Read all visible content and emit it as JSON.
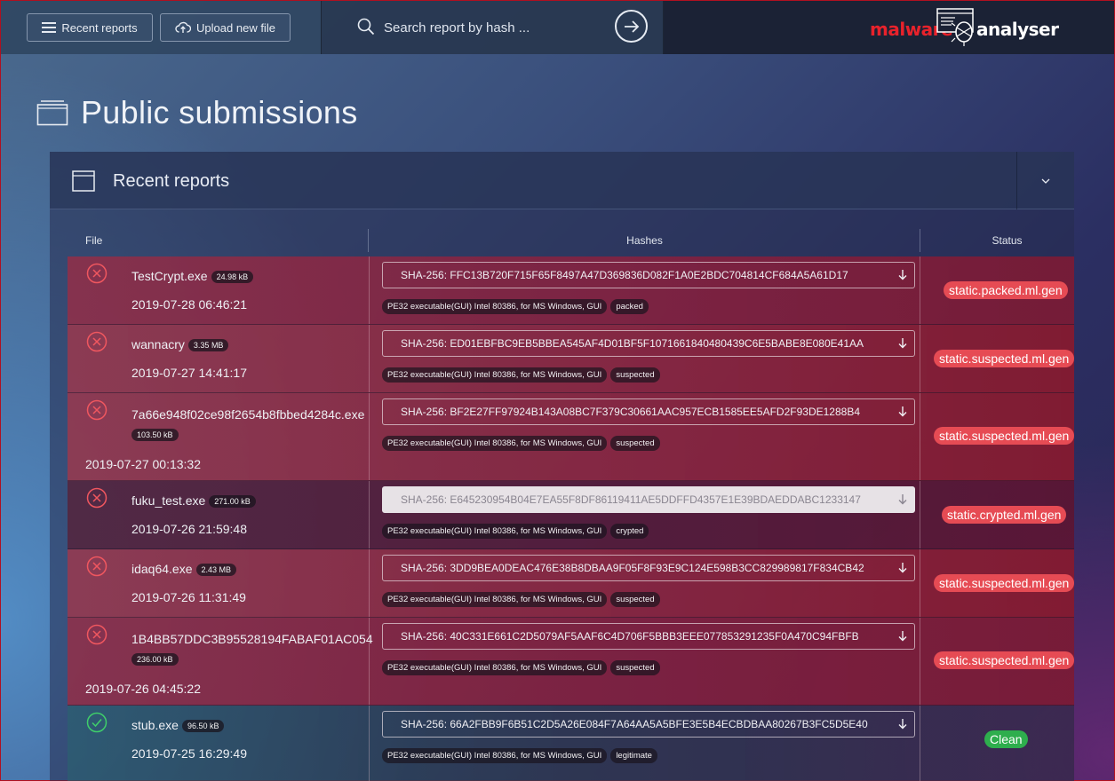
{
  "topbar": {
    "recent_label": "Recent reports",
    "upload_label": "Upload new file",
    "search_placeholder": "Search report by hash ...",
    "logo_part1": "malware",
    "logo_part2": "analyser"
  },
  "page": {
    "title": "Public submissions"
  },
  "panel": {
    "title": "Recent reports",
    "columns": {
      "file": "File",
      "hashes": "Hashes",
      "status": "Status"
    },
    "rows": [
      {
        "status_icon": "error-circle-icon",
        "name": "TestCrypt.exe",
        "size": "24.98 kB",
        "date": "2019-07-28 06:46:21",
        "hash": "SHA-256: FFC13B720F715F65F8497A47D369836D082F1A0E2BDC704814CF684A5A61D17",
        "type_tag": "PE32 executable(GUI) Intel 80386, for MS Windows, GUI",
        "class_tag": "packed",
        "status": "static.packed.ml.gen"
      },
      {
        "status_icon": "error-circle-icon",
        "name": "wannacry",
        "size": "3.35 MB",
        "date": "2019-07-27 14:41:17",
        "hash": "SHA-256: ED01EBFBC9EB5BBEA545AF4D01BF5F1071661840480439C6E5BABE8E080E41AA",
        "type_tag": "PE32 executable(GUI) Intel 80386, for MS Windows, GUI",
        "class_tag": "suspected",
        "status": "static.suspected.ml.gen"
      },
      {
        "status_icon": "error-circle-icon",
        "name": "7a66e948f02ce98f2654b8fbbed4284c.exe",
        "size": "103.50 kB",
        "date": "2019-07-27 00:13:32",
        "hash": "SHA-256: BF2E27FF97924B143A08BC7F379C30661AAC957ECB1585EE5AFD2F93DE1288B4",
        "type_tag": "PE32 executable(GUI) Intel 80386, for MS Windows, GUI",
        "class_tag": "suspected",
        "status": "static.suspected.ml.gen"
      },
      {
        "status_icon": "error-circle-icon",
        "name": "fuku_test.exe",
        "size": "271.00 kB",
        "date": "2019-07-26 21:59:48",
        "hash": "SHA-256: E645230954B04E7EA55F8DF86119411AE5DDFFD4357E1E39BDAEDDABC1233147",
        "type_tag": "PE32 executable(GUI) Intel 80386, for MS Windows, GUI",
        "class_tag": "crypted",
        "status": "static.crypted.ml.gen"
      },
      {
        "status_icon": "error-circle-icon",
        "name": "idaq64.exe",
        "size": "2.43 MB",
        "date": "2019-07-26 11:31:49",
        "hash": "SHA-256: 3DD9BEA0DEAC476E38B8DBAA9F05F8F93E9C124E598B3CC829989817F834CB42",
        "type_tag": "PE32 executable(GUI) Intel 80386, for MS Windows, GUI",
        "class_tag": "suspected",
        "status": "static.suspected.ml.gen"
      },
      {
        "status_icon": "error-circle-icon",
        "name": "1B4BB57DDC3B95528194FABAF01AC054",
        "size": "236.00 kB",
        "date": "2019-07-26 04:45:22",
        "hash": "SHA-256: 40C331E661C2D5079AF5AAF6C4D706F5BBB3EEE077853291235F0A470C94FBFB",
        "type_tag": "PE32 executable(GUI) Intel 80386, for MS Windows, GUI",
        "class_tag": "suspected",
        "status": "static.suspected.ml.gen"
      },
      {
        "status_icon": "check-circle-icon",
        "name": "stub.exe",
        "size": "96.50 kB",
        "date": "2019-07-25 16:29:49",
        "hash": "SHA-256: 66A2FBB9F6B51C2D5A26E084F7A64AA5A5BFE3E5B4ECBDBAA80267B3FC5D5E40",
        "type_tag": "PE32 executable(GUI) Intel 80386, for MS Windows, GUI",
        "class_tag": "legitimate",
        "status": "Clean"
      }
    ]
  },
  "colors": {
    "danger": "#e64b54",
    "clean": "#2eae4d",
    "brand_red": "#e8222b"
  }
}
